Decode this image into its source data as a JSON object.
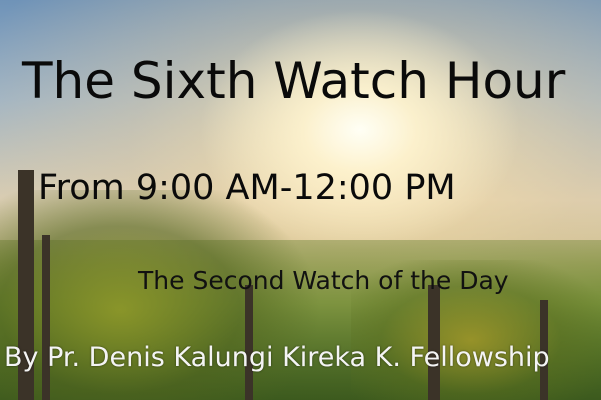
{
  "graphic": {
    "title": "The Sixth Watch Hour",
    "time_range": "From 9:00 AM-12:00 PM",
    "subtitle": "The Second Watch of the Day",
    "byline": "By Pr. Denis Kalungi Kireka K. Fellowship"
  }
}
